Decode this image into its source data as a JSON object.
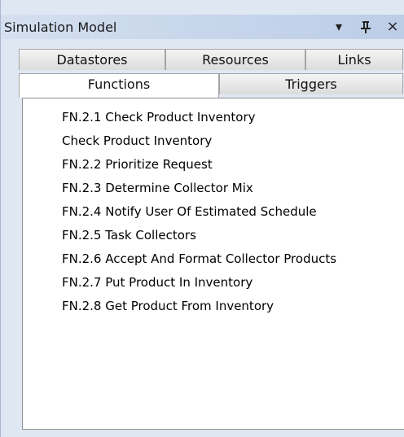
{
  "window": {
    "title": "Simulation Model",
    "dropdown_icon": "▾",
    "pin_icon": "⊥",
    "close_icon": "×"
  },
  "tabs_row1": [
    {
      "label": "Datastores"
    },
    {
      "label": "Resources"
    },
    {
      "label": "Links"
    }
  ],
  "tabs_row2": [
    {
      "label": "Functions",
      "active": true
    },
    {
      "label": "Triggers",
      "active": false
    }
  ],
  "functions": [
    "FN.2.1 Check Product Inventory",
    "Check Product Inventory",
    "FN.2.2 Prioritize Request",
    "FN.2.3 Determine Collector Mix",
    "FN.2.4 Notify User Of Estimated Schedule",
    "FN.2.5 Task Collectors",
    "FN.2.6 Accept And Format Collector Products",
    "FN.2.7 Put Product In Inventory",
    "FN.2.8 Get Product From Inventory"
  ]
}
